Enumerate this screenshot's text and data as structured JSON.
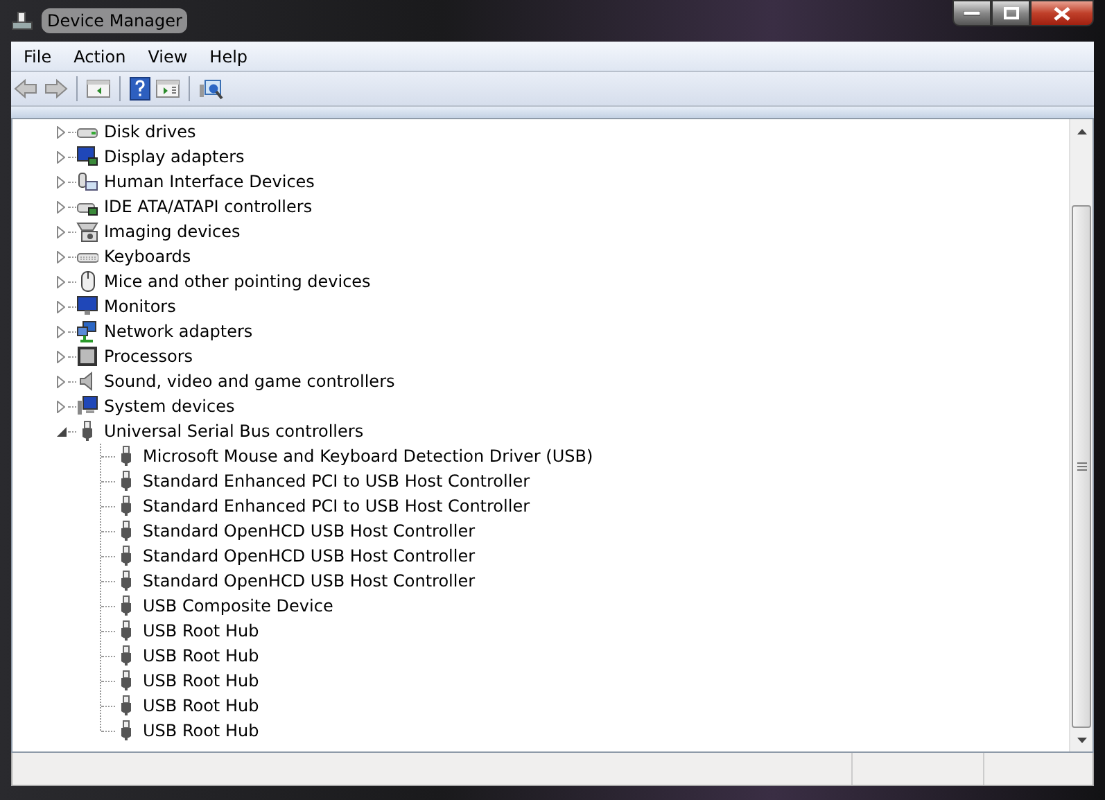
{
  "window": {
    "title": "Device Manager"
  },
  "menu": [
    "File",
    "Action",
    "View",
    "Help"
  ],
  "tree": [
    {
      "label": "Disk drives",
      "expanded": false
    },
    {
      "label": "Display adapters",
      "expanded": false
    },
    {
      "label": "Human Interface Devices",
      "expanded": false
    },
    {
      "label": "IDE ATA/ATAPI controllers",
      "expanded": false
    },
    {
      "label": "Imaging devices",
      "expanded": false
    },
    {
      "label": "Keyboards",
      "expanded": false
    },
    {
      "label": "Mice and other pointing devices",
      "expanded": false
    },
    {
      "label": "Monitors",
      "expanded": false
    },
    {
      "label": "Network adapters",
      "expanded": false
    },
    {
      "label": "Processors",
      "expanded": false
    },
    {
      "label": "Sound, video and game controllers",
      "expanded": false
    },
    {
      "label": "System devices",
      "expanded": false
    },
    {
      "label": "Universal Serial Bus controllers",
      "expanded": true,
      "children": [
        {
          "label": "Microsoft Mouse and Keyboard Detection Driver (USB)"
        },
        {
          "label": "Standard Enhanced PCI to USB Host Controller"
        },
        {
          "label": "Standard Enhanced PCI to USB Host Controller"
        },
        {
          "label": "Standard OpenHCD USB Host Controller"
        },
        {
          "label": "Standard OpenHCD USB Host Controller"
        },
        {
          "label": "Standard OpenHCD USB Host Controller"
        },
        {
          "label": "USB Composite Device"
        },
        {
          "label": "USB Root Hub"
        },
        {
          "label": "USB Root Hub"
        },
        {
          "label": "USB Root Hub"
        },
        {
          "label": "USB Root Hub"
        },
        {
          "label": "USB Root Hub"
        }
      ]
    }
  ]
}
